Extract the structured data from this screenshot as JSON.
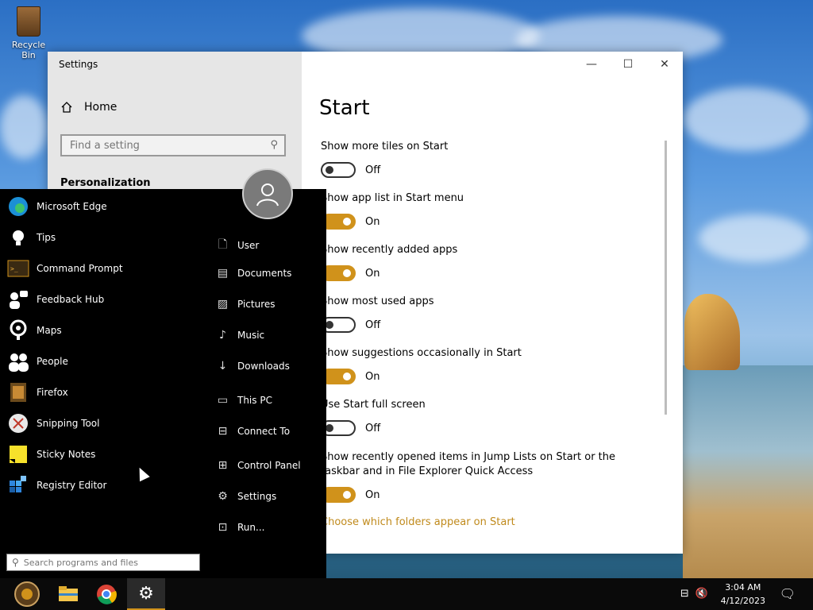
{
  "desktop": {
    "recycle_bin_label": "Recycle Bin"
  },
  "settings": {
    "window_title": "Settings",
    "home_label": "Home",
    "search_placeholder": "Find a setting",
    "section_heading": "Personalization",
    "page_title": "Start",
    "options": [
      {
        "label": "Show more tiles on Start",
        "state": "Off"
      },
      {
        "label": "Show app list in Start menu",
        "state": "On"
      },
      {
        "label": "Show recently added apps",
        "state": "On"
      },
      {
        "label": "Show most used apps",
        "state": "Off"
      },
      {
        "label": "Show suggestions occasionally in Start",
        "state": "On"
      },
      {
        "label": "Use Start full screen",
        "state": "Off"
      },
      {
        "label": "Show recently opened items in Jump Lists on Start or the taskbar and in File Explorer Quick Access",
        "state": "On"
      }
    ],
    "link": "Choose which folders appear on Start"
  },
  "start_menu": {
    "apps": [
      {
        "label": "Microsoft Edge",
        "icon": "edge-icon"
      },
      {
        "label": "Tips",
        "icon": "lightbulb-icon"
      },
      {
        "label": "Command Prompt",
        "icon": "terminal-icon"
      },
      {
        "label": "Feedback Hub",
        "icon": "feedback-icon"
      },
      {
        "label": "Maps",
        "icon": "map-pin-icon"
      },
      {
        "label": "People",
        "icon": "people-icon"
      },
      {
        "label": "Firefox",
        "icon": "firefox-icon"
      },
      {
        "label": "Snipping Tool",
        "icon": "scissors-icon"
      },
      {
        "label": "Sticky Notes",
        "icon": "sticky-note-icon"
      },
      {
        "label": "Registry Editor",
        "icon": "registry-icon"
      }
    ],
    "places": [
      {
        "label": "User",
        "icon": "user-file-icon"
      },
      {
        "label": "Documents",
        "icon": "document-icon"
      },
      {
        "label": "Pictures",
        "icon": "picture-icon"
      },
      {
        "label": "Music",
        "icon": "music-icon"
      },
      {
        "label": "Downloads",
        "icon": "download-icon"
      },
      {
        "label": "This PC",
        "icon": "computer-icon"
      },
      {
        "label": "Connect To",
        "icon": "connect-icon"
      },
      {
        "label": "Control Panel",
        "icon": "control-panel-icon"
      },
      {
        "label": "Settings",
        "icon": "gear-icon"
      },
      {
        "label": "Run...",
        "icon": "run-icon"
      }
    ],
    "search_placeholder": "Search programs and files"
  },
  "taskbar": {
    "time": "3:04 AM",
    "date": "4/12/2023"
  },
  "colors": {
    "accent": "#d0921b",
    "link": "#c08a1c"
  }
}
